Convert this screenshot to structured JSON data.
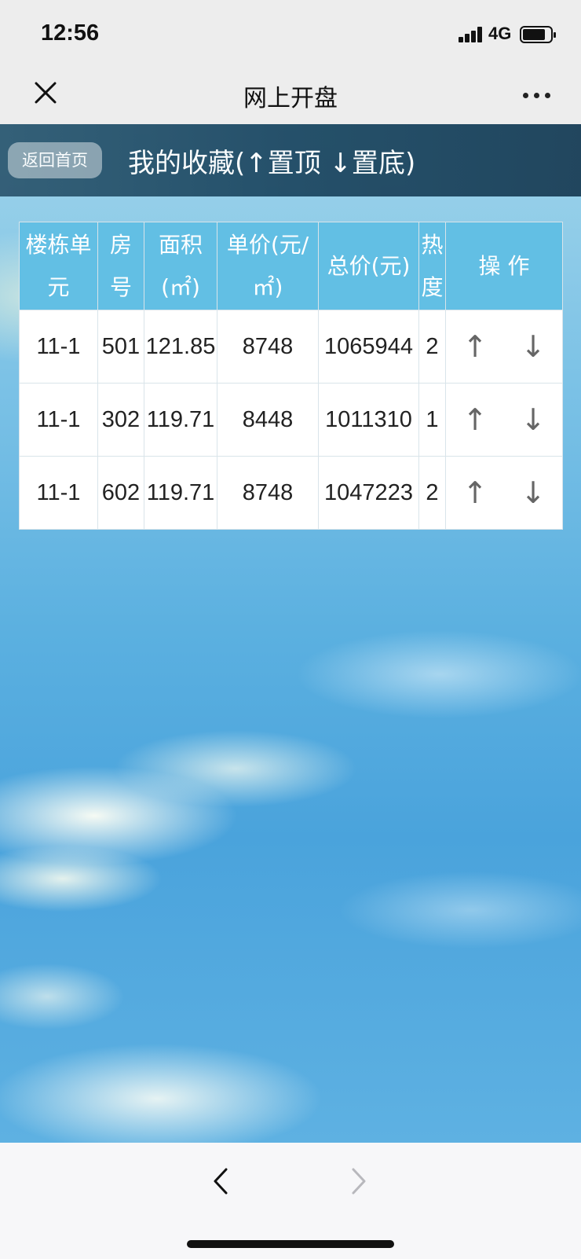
{
  "status_bar": {
    "time": "12:56",
    "network": "4G",
    "battery_level_fraction": 0.75
  },
  "nav_bar": {
    "title": "网上开盘",
    "close_icon": "close-icon",
    "more_icon": "more-icon"
  },
  "page_header": {
    "back_home_label": "返回首页",
    "title": "我的收藏(↑置顶 ↓置底)"
  },
  "table": {
    "headers": [
      "楼栋单元",
      "房号",
      "面积(㎡)",
      "单价(元/㎡)",
      "总价(元)",
      "热度",
      "操 作"
    ],
    "rows": [
      {
        "unit": "11-1",
        "room": "501",
        "area": "121.85",
        "unit_price": "8748",
        "total_price": "1065944",
        "heat": "2",
        "up": "↑",
        "down": "↓"
      },
      {
        "unit": "11-1",
        "room": "302",
        "area": "119.71",
        "unit_price": "8448",
        "total_price": "1011310",
        "heat": "1",
        "up": "↑",
        "down": "↓"
      },
      {
        "unit": "11-1",
        "room": "602",
        "area": "119.71",
        "unit_price": "8748",
        "total_price": "1047223",
        "heat": "2",
        "up": "↑",
        "down": "↓"
      }
    ]
  },
  "bottom_bar": {
    "back_icon": "chevron-left-icon",
    "forward_icon": "chevron-right-icon",
    "forward_enabled": false
  }
}
